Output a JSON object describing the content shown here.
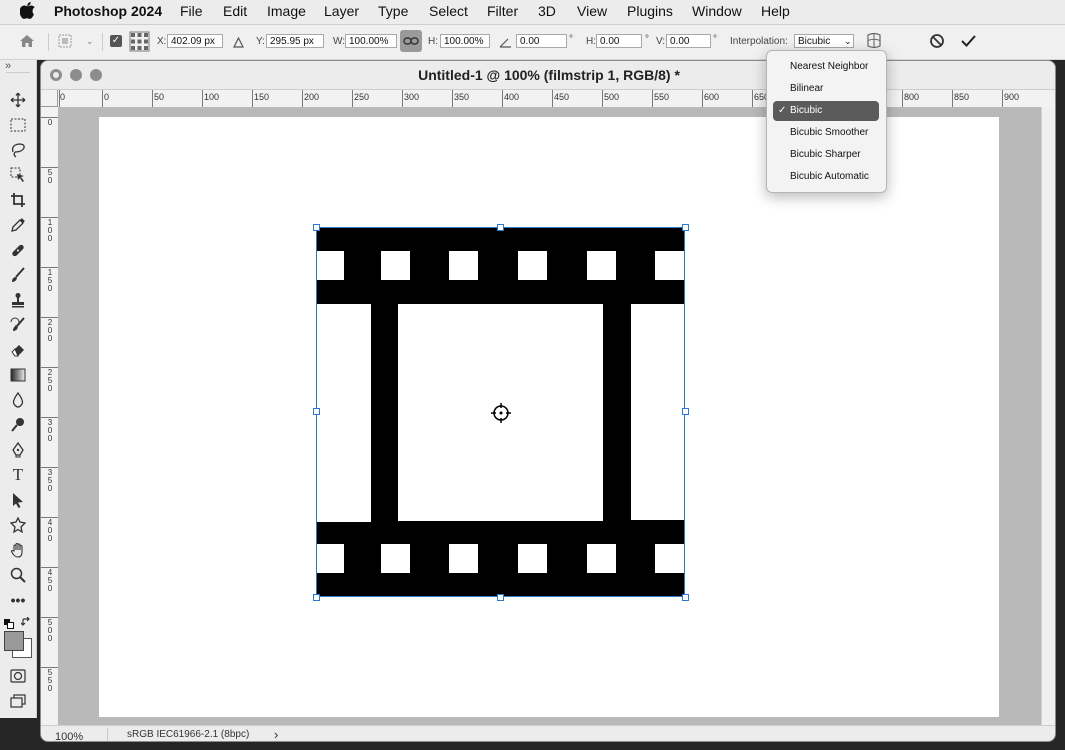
{
  "menubar": {
    "app_name": "Photoshop 2024",
    "items": [
      "File",
      "Edit",
      "Image",
      "Layer",
      "Type",
      "Select",
      "Filter",
      "3D",
      "View",
      "Plugins",
      "Window",
      "Help"
    ]
  },
  "options_bar": {
    "x_label": "X:",
    "x_value": "402.09 px",
    "y_label": "Y:",
    "y_value": "295.95 px",
    "w_label": "W:",
    "w_value": "100.00%",
    "h_label": "H:",
    "h_value": "100.00%",
    "angle_value": "0.00",
    "angle_unit": "°",
    "hskew_label": "H:",
    "hskew_value": "0.00",
    "hskew_unit": "°",
    "vskew_label": "V:",
    "vskew_value": "0.00",
    "vskew_unit": "°",
    "interpolation_label": "Interpolation:",
    "interpolation_value": "Bicubic"
  },
  "interpolation_menu": {
    "options": [
      "Nearest Neighbor",
      "Bilinear",
      "Bicubic",
      "Bicubic Smoother",
      "Bicubic Sharper",
      "Bicubic Automatic"
    ],
    "selected": "Bicubic",
    "check_glyph": "✓"
  },
  "document": {
    "title": "Untitled-1 @ 100% (filmstrip 1, RGB/8) *",
    "zoom": "100%",
    "color_profile": "sRGB IEC61966-2.1 (8bpc)",
    "status_arrow": "›"
  },
  "rulers": {
    "top_labels": [
      "0",
      "0",
      "50",
      "100",
      "150",
      "200",
      "250",
      "300",
      "350",
      "400",
      "450",
      "500",
      "550",
      "600",
      "650",
      "800",
      "850",
      "900"
    ],
    "left_labels": [
      [
        "0"
      ],
      [
        "5",
        "0"
      ],
      [
        "1",
        "0",
        "0"
      ],
      [
        "1",
        "5",
        "0"
      ],
      [
        "2",
        "0",
        "0"
      ],
      [
        "2",
        "5",
        "0"
      ],
      [
        "3",
        "0",
        "0"
      ],
      [
        "3",
        "5",
        "0"
      ],
      [
        "4",
        "0",
        "0"
      ],
      [
        "4",
        "5",
        "0"
      ],
      [
        "5",
        "0",
        "0"
      ],
      [
        "5",
        "5",
        "0"
      ]
    ]
  },
  "tools": [
    "move-tool",
    "marquee-tool",
    "lasso-tool",
    "object-select-tool",
    "crop-tool",
    "eyedropper-tool",
    "healing-brush-tool",
    "brush-tool",
    "clone-stamp-tool",
    "history-brush-tool",
    "eraser-tool",
    "gradient-tool",
    "blur-tool",
    "dodge-tool",
    "pen-tool",
    "type-tool",
    "path-select-tool",
    "shape-tool",
    "hand-tool",
    "zoom-tool",
    "more-tools",
    "default-colors",
    "swap-colors",
    "foreground-color",
    "background-color",
    "quick-mask",
    "screen-mode"
  ],
  "colors": {
    "foreground": "#9a9a9a",
    "background": "#ffffff",
    "selection_handle": "#2c79c9",
    "filmstrip": "#000000"
  }
}
